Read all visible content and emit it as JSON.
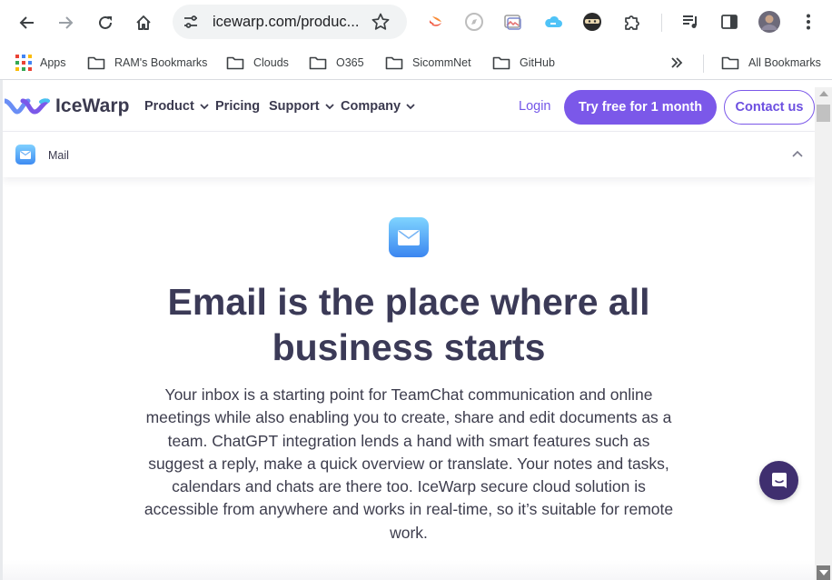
{
  "browser": {
    "url": "icewarp.com/produc...",
    "bookmarks": [
      {
        "label": "Apps",
        "icon": "apps-grid-icon"
      },
      {
        "label": "RAM's Bookmarks",
        "icon": "folder-icon"
      },
      {
        "label": "Clouds",
        "icon": "folder-icon"
      },
      {
        "label": "O365",
        "icon": "folder-icon"
      },
      {
        "label": "SicommNet",
        "icon": "folder-icon"
      },
      {
        "label": "GitHub",
        "icon": "folder-icon"
      }
    ],
    "all_bookmarks": "All Bookmarks"
  },
  "site": {
    "brand": "IceWarp",
    "nav": {
      "product": "Product",
      "pricing": "Pricing",
      "support": "Support",
      "company": "Company"
    },
    "login": "Login",
    "try_button": "Try free for 1 month",
    "contact_button": "Contact us",
    "subnav_label": "Mail"
  },
  "hero": {
    "title": "Email is the place where all business starts",
    "body": "Your inbox is a starting point for TeamChat communication and online meetings while also enabling you to create, share and edit documents as a team. ChatGPT integration lends a hand with smart features such as suggest a reply, make a quick overview or translate. Your notes and tasks, calendars and chats are there too. IceWarp secure cloud solution is accessible from anywhere and works in real-time, so it’s suitable for remote work."
  },
  "colors": {
    "accent": "#7b58e9",
    "heading": "#3b3a57",
    "chat_button": "#3f2f6f"
  }
}
